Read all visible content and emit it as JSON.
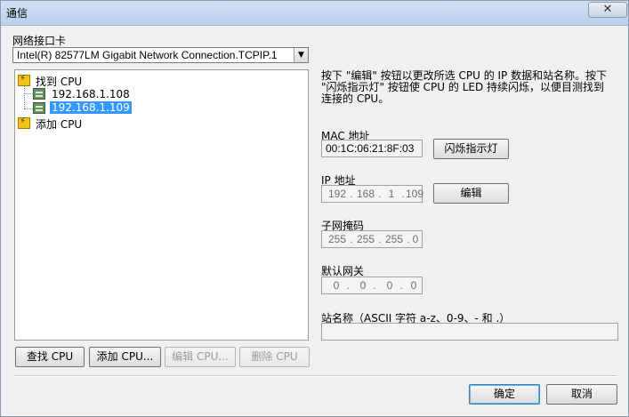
{
  "window": {
    "title": "通信",
    "close_symbol": "✕"
  },
  "network_card": {
    "label": "网络接口卡",
    "value": "Intel(R) 82577LM Gigabit Network Connection.TCPIP.1",
    "arrow": "▼"
  },
  "tree": {
    "items": [
      {
        "label": "找到 CPU",
        "icon": "lightning-icon"
      },
      {
        "label": "192.168.1.108",
        "icon": "plc-device-icon"
      },
      {
        "label": "192.168.1.109",
        "icon": "plc-device-icon",
        "selected": true
      },
      {
        "label": "添加 CPU",
        "icon": "lightning-icon"
      }
    ]
  },
  "description": "按下 \"编辑\" 按钮以更改所选 CPU 的 IP 数据和站名称。按下 \"闪烁指示灯\" 按钮使 CPU 的 LED 持续闪烁，以便目测找到连接的 CPU。",
  "mac": {
    "label": "MAC 地址",
    "value": "00:1C:06:21:8F:03",
    "button": "闪烁指示灯"
  },
  "ip": {
    "label": "IP 地址",
    "segments": [
      "192",
      "168",
      "1",
      "109"
    ],
    "button": "编辑"
  },
  "subnet": {
    "label": "子网掩码",
    "segments": [
      "255",
      "255",
      "255",
      "0"
    ]
  },
  "gateway": {
    "label": "默认网关",
    "segments": [
      "0",
      "0",
      "0",
      "0"
    ]
  },
  "station": {
    "label": "站名称（ASCII 字符 a-z、0-9、- 和 .）",
    "value": ""
  },
  "buttons": {
    "find_cpu": "查找 CPU",
    "add_cpu": "添加 CPU...",
    "edit_cpu": "编辑 CPU...",
    "delete_cpu": "删除 CPU",
    "ok": "确定",
    "cancel": "取消"
  },
  "colors": {
    "selection": "#3399ff",
    "titlebar": "#c4d9f0"
  }
}
